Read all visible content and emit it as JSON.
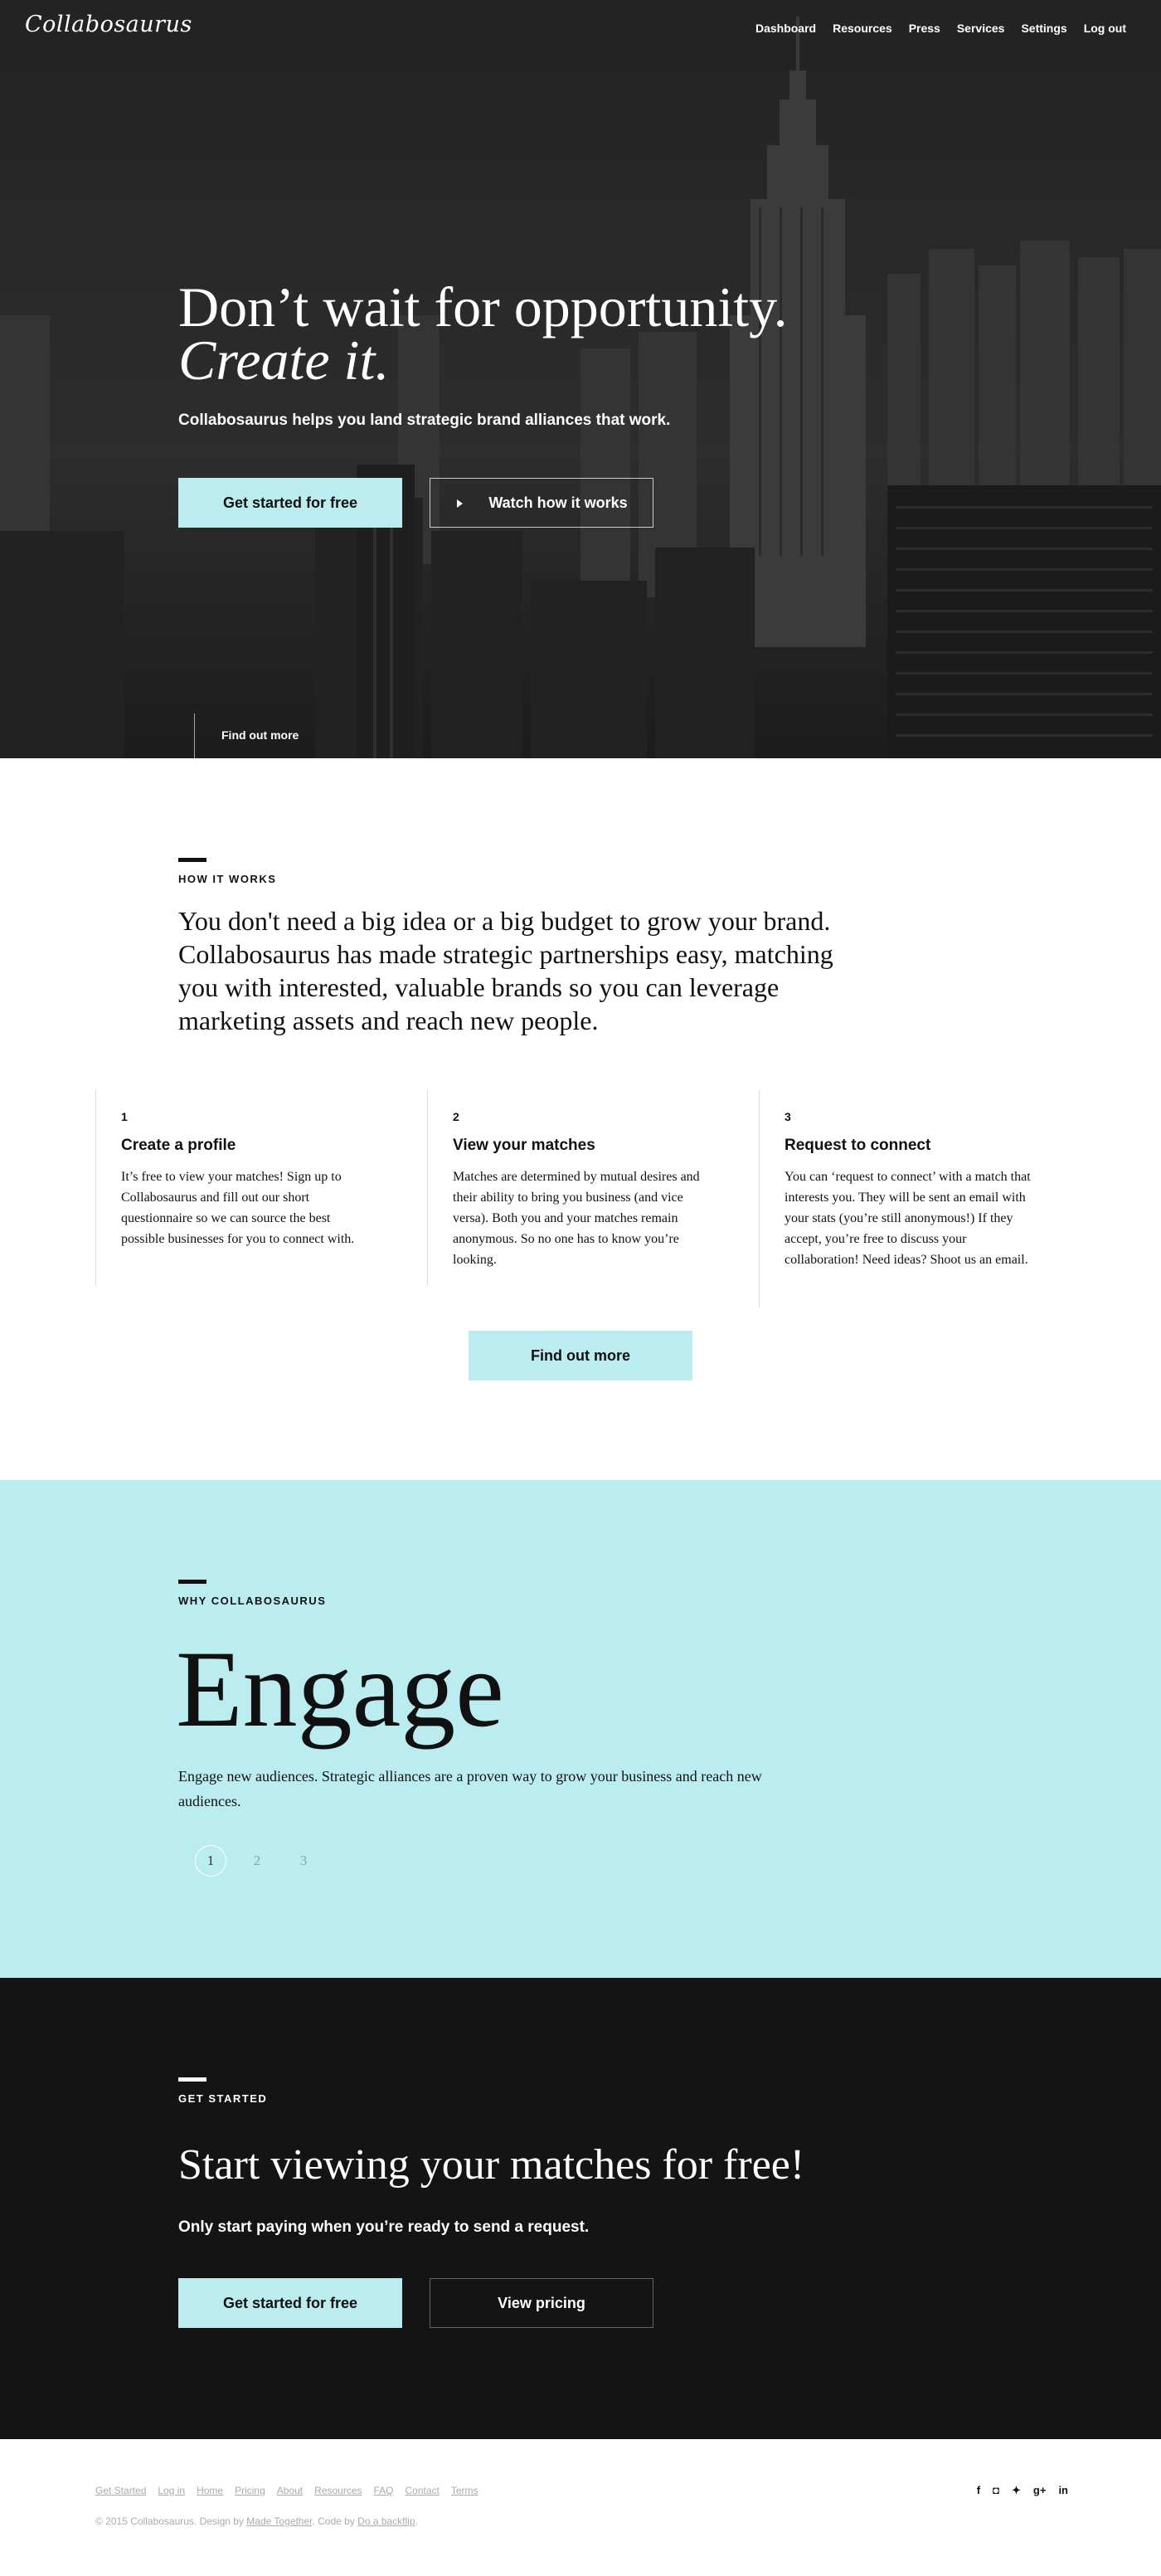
{
  "nav": {
    "logo": "Collabosaurus",
    "links": [
      "Dashboard",
      "Resources",
      "Press",
      "Services",
      "Settings",
      "Log out"
    ]
  },
  "hero": {
    "title_line1": "Don’t wait for opportunity.",
    "title_line2": "Create it.",
    "subtitle": "Collabosaurus helps you land strategic brand alliances that work.",
    "cta_primary": "Get started for free",
    "cta_secondary": "Watch how it works",
    "find_more": "Find out more"
  },
  "how": {
    "eyebrow": "HOW IT WORKS",
    "body": "You don't need a big idea or a big budget to grow your brand. Collabosaurus has made strategic partnerships easy, matching you with interested, valuable brands so you can leverage marketing assets and reach new people.",
    "steps": [
      {
        "num": "1",
        "title": "Create a profile",
        "text": "It’s free to view your matches! Sign up to Collabosaurus and fill out our short questionnaire so we can source the best possible businesses for you to connect with."
      },
      {
        "num": "2",
        "title": "View your matches",
        "text": "Matches are determined by mutual desires and their ability to bring you business (and vice versa). Both you and your matches remain anonymous. So no one has to know you’re looking."
      },
      {
        "num": "3",
        "title": "Request to connect",
        "text": "You can ‘request to connect’ with a match that interests you. They will be sent an email with your stats (you’re still anonymous!) If they accept, you’re free to discuss your collaboration! Need ideas? Shoot us an email."
      }
    ],
    "button": "Find out more"
  },
  "why": {
    "eyebrow": "WHY COLLABOSAURUS",
    "headline": "Engage",
    "text": "Engage new audiences. Strategic alliances are a proven way to grow your business and reach new audiences.",
    "pages": [
      "1",
      "2",
      "3"
    ],
    "active_page": "1"
  },
  "get_started": {
    "eyebrow": "GET STARTED",
    "title": "Start viewing your matches for free!",
    "subtitle": "Only start paying when you’re ready to send a request.",
    "cta_primary": "Get started for free",
    "cta_secondary": "View pricing"
  },
  "footer": {
    "links": [
      "Get Started",
      "Log in",
      "Home",
      "Pricing",
      "About",
      "Resources",
      "FAQ",
      "Contact",
      "Terms"
    ],
    "copyright_prefix": "© 2015 Collabosaurus. Design by ",
    "design_by": "Made Together",
    "code_prefix": ". Code by ",
    "code_by": "Do a backflip",
    "copyright_suffix": ".",
    "social": [
      {
        "icon": "facebook-icon",
        "glyph": "f"
      },
      {
        "icon": "instagram-icon",
        "glyph": "◘"
      },
      {
        "icon": "twitter-icon",
        "glyph": "✦"
      },
      {
        "icon": "google-plus-icon",
        "glyph": "g+"
      },
      {
        "icon": "linkedin-icon",
        "glyph": "in"
      }
    ]
  },
  "colors": {
    "accent": "#bbecef",
    "dark": "#141414",
    "hero_bg": "#262626"
  }
}
